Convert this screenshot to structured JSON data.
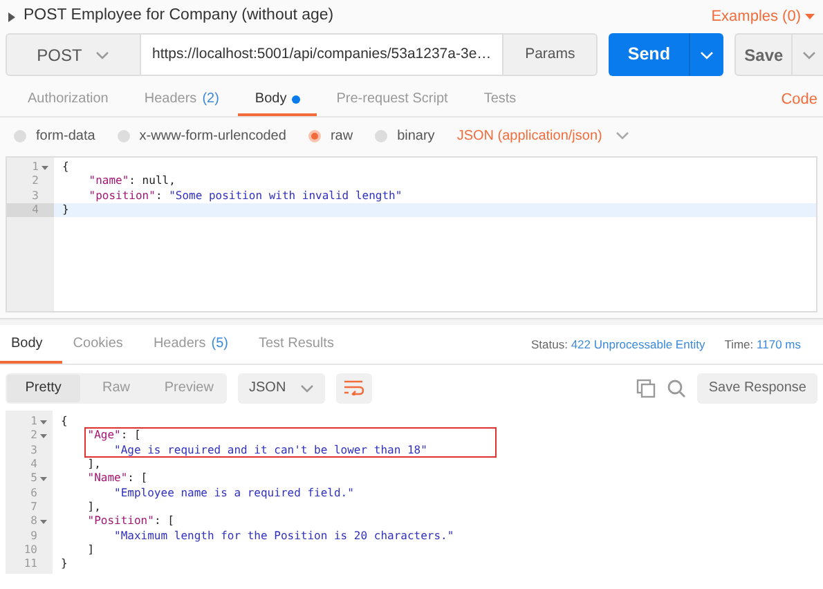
{
  "request": {
    "title": "POST Employee for Company (without age)",
    "examples": "Examples (0)",
    "method": "POST",
    "url": "https://localhost:5001/api/companies/53a1237a-3e…",
    "params": "Params",
    "send": "Send",
    "save": "Save"
  },
  "request_tabs": [
    {
      "label": "Authorization",
      "selected": false
    },
    {
      "label": "Headers",
      "count": "(2)",
      "selected": false
    },
    {
      "label": "Body",
      "selected": true,
      "dot": true
    },
    {
      "label": "Pre-request Script",
      "selected": false
    },
    {
      "label": "Tests",
      "selected": false
    }
  ],
  "code_link": "Code",
  "body_types": [
    {
      "label": "form-data",
      "selected": false
    },
    {
      "label": "x-www-form-urlencoded",
      "selected": false
    },
    {
      "label": "raw",
      "selected": true
    },
    {
      "label": "binary",
      "selected": false
    }
  ],
  "content_type": "JSON (application/json)",
  "request_body": [
    {
      "number": "1",
      "foldable": true,
      "selected": false,
      "tokens": [
        {
          "kind": "punct",
          "text": "{"
        }
      ]
    },
    {
      "number": "2",
      "foldable": false,
      "selected": false,
      "tokens": [
        {
          "kind": "key",
          "text": "    \"name\""
        },
        {
          "kind": "punct",
          "text": ": null,"
        }
      ]
    },
    {
      "number": "3",
      "foldable": false,
      "selected": false,
      "tokens": [
        {
          "kind": "key",
          "text": "    \"position\""
        },
        {
          "kind": "punct",
          "text": ": "
        },
        {
          "kind": "string",
          "text": "\"Some position with invalid length\""
        }
      ]
    },
    {
      "number": "4",
      "foldable": false,
      "selected": true,
      "tokens": [
        {
          "kind": "punct",
          "text": "}"
        }
      ]
    }
  ],
  "response_tabs": [
    {
      "label": "Body",
      "selected": true
    },
    {
      "label": "Cookies",
      "selected": false
    },
    {
      "label": "Headers",
      "count": "(5)",
      "selected": false
    },
    {
      "label": "Test Results",
      "selected": false
    }
  ],
  "status": {
    "label": "Status:",
    "value": "422 Unprocessable Entity",
    "time_label": "Time:",
    "time": "1170 ms"
  },
  "view_modes": [
    {
      "label": "Pretty",
      "selected": true
    },
    {
      "label": "Raw",
      "selected": false
    },
    {
      "label": "Preview",
      "selected": false
    }
  ],
  "format": "JSON",
  "save_response": "Save Response",
  "response_body": [
    {
      "number": "1",
      "foldable": true,
      "boxed": false,
      "tokens": [
        {
          "kind": "punct",
          "text": "{"
        }
      ]
    },
    {
      "number": "2",
      "foldable": true,
      "boxed": true,
      "tokens": [
        {
          "kind": "key",
          "text": "    \"Age\""
        },
        {
          "kind": "punct",
          "text": ": ["
        }
      ]
    },
    {
      "number": "3",
      "foldable": false,
      "boxed": true,
      "tokens": [
        {
          "kind": "string",
          "text": "        \"Age is required and it can't be lower than 18\""
        }
      ]
    },
    {
      "number": "4",
      "foldable": false,
      "boxed": false,
      "tokens": [
        {
          "kind": "punct",
          "text": "    ],"
        }
      ]
    },
    {
      "number": "5",
      "foldable": true,
      "boxed": false,
      "tokens": [
        {
          "kind": "key",
          "text": "    \"Name\""
        },
        {
          "kind": "punct",
          "text": ": ["
        }
      ]
    },
    {
      "number": "6",
      "foldable": false,
      "boxed": false,
      "tokens": [
        {
          "kind": "string",
          "text": "        \"Employee name is a required field.\""
        }
      ]
    },
    {
      "number": "7",
      "foldable": false,
      "boxed": false,
      "tokens": [
        {
          "kind": "punct",
          "text": "    ],"
        }
      ]
    },
    {
      "number": "8",
      "foldable": true,
      "boxed": false,
      "tokens": [
        {
          "kind": "key",
          "text": "    \"Position\""
        },
        {
          "kind": "punct",
          "text": ": ["
        }
      ]
    },
    {
      "number": "9",
      "foldable": false,
      "boxed": false,
      "tokens": [
        {
          "kind": "string",
          "text": "        \"Maximum length for the Position is 20 characters.\""
        }
      ]
    },
    {
      "number": "10",
      "foldable": false,
      "boxed": false,
      "tokens": [
        {
          "kind": "punct",
          "text": "    ]"
        }
      ]
    },
    {
      "number": "11",
      "foldable": false,
      "boxed": false,
      "tokens": [
        {
          "kind": "punct",
          "text": "}"
        }
      ]
    }
  ]
}
